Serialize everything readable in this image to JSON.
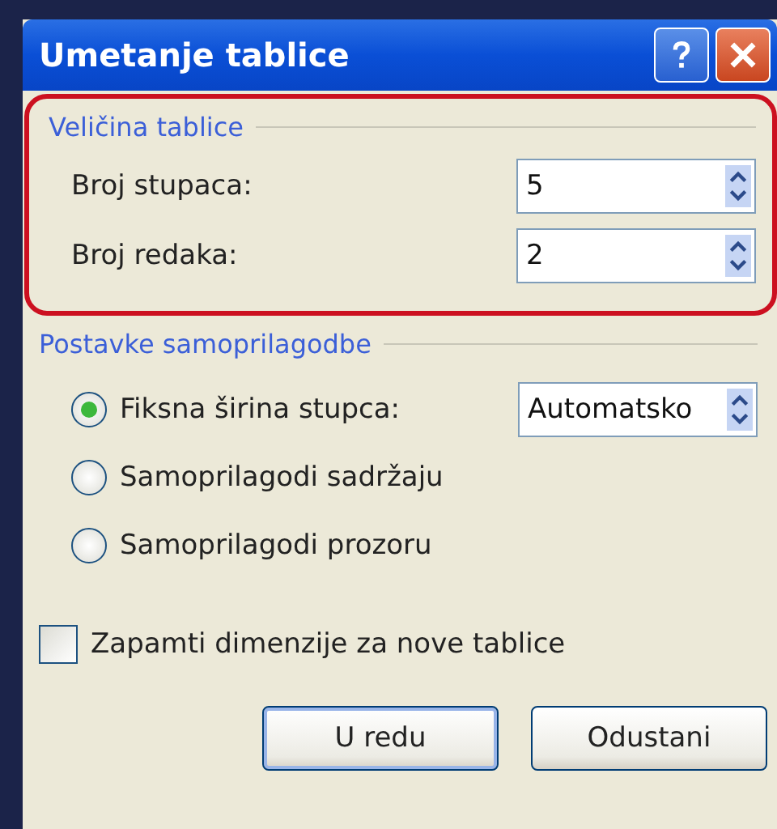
{
  "window": {
    "title": "Umetanje tablice"
  },
  "size_group": {
    "title": "Veličina tablice",
    "highlighted": true,
    "fields": [
      {
        "label": "Broj stupaca:",
        "value": "5"
      },
      {
        "label": "Broj redaka:",
        "value": "2"
      }
    ]
  },
  "autofit_group": {
    "title": "Postavke samoprilagodbe",
    "options": [
      {
        "label": "Fiksna širina stupca:",
        "selected": true,
        "value": "Automatsko"
      },
      {
        "label": "Samoprilagodi sadržaju",
        "selected": false
      },
      {
        "label": "Samoprilagodi prozoru",
        "selected": false
      }
    ]
  },
  "remember": {
    "label": "Zapamti dimenzije za nove tablice",
    "checked": false
  },
  "buttons": [
    {
      "label": "U redu",
      "default": true
    },
    {
      "label": "Odustani",
      "default": false
    }
  ]
}
